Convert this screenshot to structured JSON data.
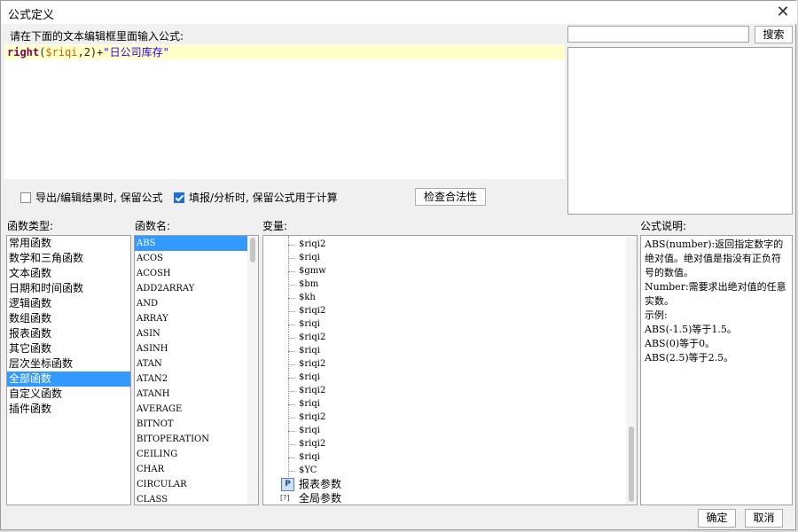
{
  "window": {
    "title": "公式定义",
    "close_symbol": "✕"
  },
  "editor": {
    "prompt": "请在下面的文本编辑框里面输入公式:",
    "formula": {
      "fn": "right",
      "open": "(",
      "var": "$riqi",
      "args": ",2)+",
      "str": "\"日公司库存\""
    }
  },
  "search": {
    "value": "",
    "button": "搜索"
  },
  "options": [
    {
      "label": "导出/编辑结果时, 保留公式",
      "checked": false
    },
    {
      "label": "填报/分析时, 保留公式用于计算",
      "checked": true
    }
  ],
  "check_button": "检查合法性",
  "function_types": {
    "label": "函数类型:",
    "items": [
      "常用函数",
      "数学和三角函数",
      "文本函数",
      "日期和时间函数",
      "逻辑函数",
      "数组函数",
      "报表函数",
      "其它函数",
      "层次坐标函数",
      "全部函数",
      "自定义函数",
      "插件函数"
    ],
    "selected_index": 9
  },
  "function_names": {
    "label": "函数名:",
    "items": [
      "ABS",
      "ACOS",
      "ACOSH",
      "ADD2ARRAY",
      "AND",
      "ARRAY",
      "ASIN",
      "ASINH",
      "ATAN",
      "ATAN2",
      "ATANH",
      "AVERAGE",
      "BITNOT",
      "BITOPERATION",
      "CEILING",
      "CHAR",
      "CIRCULAR",
      "CLASS"
    ],
    "selected_index": 0
  },
  "variables": {
    "label": "变量:",
    "items": [
      "$riqi2",
      "$riqi",
      "$gmw",
      "$bm",
      "$kh",
      "$riqi2",
      "$riqi",
      "$riqi2",
      "$riqi",
      "$riqi2",
      "$riqi",
      "$riqi2",
      "$riqi",
      "$riqi2",
      "$riqi",
      "$riqi2",
      "$riqi",
      "$YC"
    ],
    "report_params": {
      "icon": "P",
      "label": "报表参数"
    },
    "global_params": {
      "icon": "[?]",
      "label": "全局参数"
    }
  },
  "description": {
    "label": "公式说明:",
    "lines": [
      "ABS(number):返回指定数字的绝对值。绝对值是指没有正负符号的数值。",
      "Number:需要求出绝对值的任意实数。",
      "示例:",
      "ABS(-1.5)等于1.5。",
      "ABS(0)等于0。",
      "ABS(2.5)等于2.5。"
    ]
  },
  "buttons": {
    "ok": "确定",
    "cancel": "取消"
  }
}
